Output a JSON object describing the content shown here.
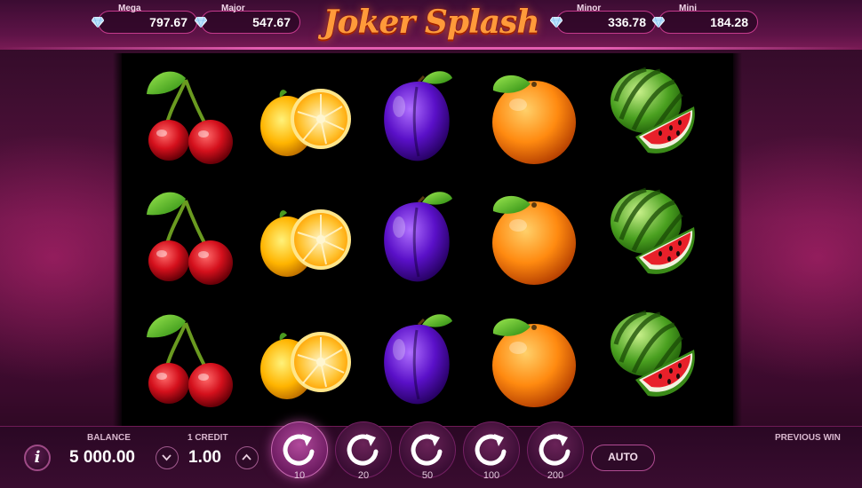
{
  "game": {
    "logo_text": "Joker Splash"
  },
  "jackpots": [
    {
      "name": "Mega",
      "value": "797.67"
    },
    {
      "name": "Major",
      "value": "547.67"
    },
    {
      "name": "Minor",
      "value": "336.78"
    },
    {
      "name": "Mini",
      "value": "184.28"
    }
  ],
  "reels": {
    "columns": [
      {
        "symbol": "cherries",
        "rows": [
          "cherries",
          "cherries",
          "cherries"
        ]
      },
      {
        "symbol": "lemon",
        "rows": [
          "lemon",
          "lemon",
          "lemon"
        ]
      },
      {
        "symbol": "plum",
        "rows": [
          "plum",
          "plum",
          "plum"
        ]
      },
      {
        "symbol": "orange",
        "rows": [
          "orange",
          "orange",
          "orange"
        ]
      },
      {
        "symbol": "watermelon",
        "rows": [
          "watermelon",
          "watermelon",
          "watermelon"
        ]
      }
    ]
  },
  "controls": {
    "info_label": "i",
    "balance_label": "BALANCE",
    "balance_value": "5 000.00",
    "credit_label": "1 CREDIT",
    "credit_value": "1.00",
    "bet_buttons": [
      {
        "amount": "10",
        "active": true
      },
      {
        "amount": "20",
        "active": false
      },
      {
        "amount": "50",
        "active": false
      },
      {
        "amount": "100",
        "active": false
      },
      {
        "amount": "200",
        "active": false
      }
    ],
    "auto_label": "AUTO",
    "previous_win_label": "PREVIOUS WIN"
  },
  "colors": {
    "accent": "#c43a8c",
    "logo": "#ff9a3a"
  },
  "icons": [
    "diamond-icon",
    "info-icon",
    "chevron-down-icon",
    "chevron-up-icon",
    "spin-arrow-icon"
  ]
}
